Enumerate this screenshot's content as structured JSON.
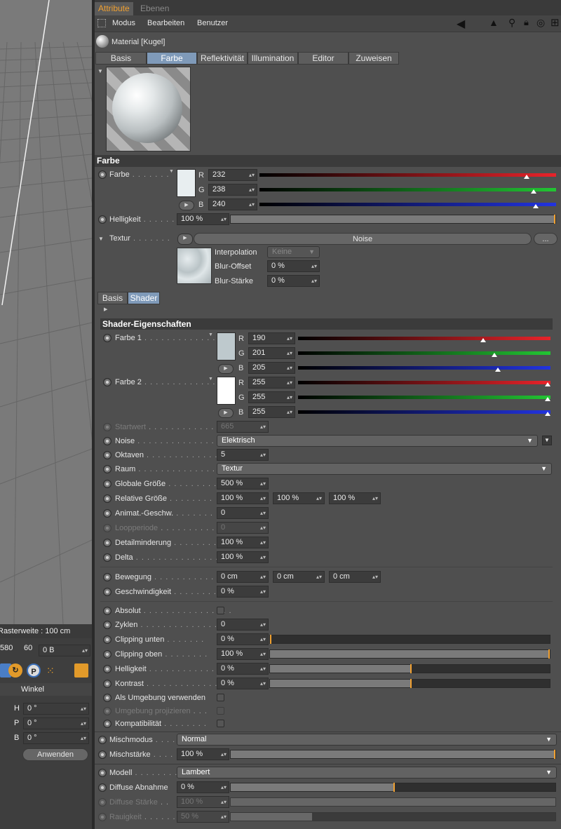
{
  "window_tabs": {
    "attribute": "Attribute",
    "ebenen": "Ebenen"
  },
  "menu": {
    "modus": "Modus",
    "bearbeiten": "Bearbeiten",
    "benutzer": "Benutzer"
  },
  "header": {
    "title": "Material [Kugel]"
  },
  "tabs": [
    "Basis",
    "Farbe",
    "Reflektivität",
    "Illumination",
    "Editor",
    "Zuweisen"
  ],
  "farbe_section": {
    "title": "Farbe",
    "farbe_label": "Farbe",
    "r": "232",
    "g": "238",
    "b": "240",
    "r_frac": 0.91,
    "g_frac": 0.933,
    "b_frac": 0.941,
    "swatch_color": "#e8eef0",
    "helligkeit_label": "Helligkeit",
    "helligkeit": "100 %",
    "textur_label": "Textur",
    "textur_button": "Noise",
    "more_button": "...",
    "interpolation_label": "Interpolation",
    "interpolation": "Keine",
    "blur_offset_label": "Blur-Offset",
    "blur_offset": "0 %",
    "blur_staerke_label": "Blur-Stärke",
    "blur_staerke": "0 %"
  },
  "shader_tabs": [
    "Basis",
    "Shader"
  ],
  "shader": {
    "title": "Shader-Eigenschaften",
    "farbe1_label": "Farbe 1",
    "farbe1": {
      "r": "190",
      "g": "201",
      "b": "205",
      "r_frac": 0.745,
      "g_frac": 0.788,
      "b_frac": 0.804,
      "color": "#bec9cd"
    },
    "farbe2_label": "Farbe 2",
    "farbe2": {
      "r": "255",
      "g": "255",
      "b": "255",
      "r_frac": 1.0,
      "g_frac": 1.0,
      "b_frac": 1.0,
      "color": "#ffffff"
    },
    "startwert_label": "Startwert",
    "startwert": "665",
    "noise_label": "Noise",
    "noise": "Elektrisch",
    "oktaven_label": "Oktaven",
    "oktaven": "5",
    "raum_label": "Raum",
    "raum": "Textur",
    "globale_groesse_label": "Globale Größe",
    "globale_groesse": "500 %",
    "relative_groesse_label": "Relative Größe",
    "relative_groesse": [
      "100 %",
      "100 %",
      "100 %"
    ],
    "animat_label": "Animat.-Geschw.",
    "animat": "0",
    "loopperiode_label": "Loopperiode",
    "loopperiode": "0",
    "detailminderung_label": "Detailminderung",
    "detailminderung": "100 %",
    "delta_label": "Delta",
    "delta": "100 %",
    "bewegung_label": "Bewegung",
    "bewegung": [
      "0 cm",
      "0 cm",
      "0 cm"
    ],
    "geschwindigkeit_label": "Geschwindigkeit",
    "geschwindigkeit": "0 %",
    "absolut_label": "Absolut",
    "zyklen_label": "Zyklen",
    "zyklen": "0",
    "clipping_unten_label": "Clipping unten",
    "clipping_unten": "0 %",
    "clipping_unten_frac": 0.0,
    "clipping_oben_label": "Clipping oben",
    "clipping_oben": "100 %",
    "clipping_oben_frac": 1.0,
    "helligkeit_label": "Helligkeit",
    "helligkeit": "0 %",
    "helligkeit_frac": 0.5,
    "kontrast_label": "Kontrast",
    "kontrast": "0 %",
    "kontrast_frac": 0.5,
    "als_umgebung_label": "Als Umgebung verwenden",
    "umgebung_projizieren_label": "Umgebung projizieren",
    "kompatibilitaet_label": "Kompatibilität"
  },
  "mix": {
    "mischmodus_label": "Mischmodus",
    "mischmodus": "Normal",
    "mischstaerke_label": "Mischstärke",
    "mischstaerke": "100 %",
    "mischstaerke_frac": 1.0
  },
  "modell": {
    "modell_label": "Modell",
    "modell": "Lambert",
    "diffuse_abnahme_label": "Diffuse Abnahme",
    "diffuse_abnahme": "0 %",
    "diffuse_abnahme_frac": 0.5,
    "diffuse_staerke_label": "Diffuse Stärke",
    "diffuse_staerke": "100 %",
    "rauigkeit_label": "Rauigkeit",
    "rauigkeit": "50 %",
    "rauigkeit_frac": 0.25
  },
  "viewport": {
    "rasterweite": "Rasterweite : 100 cm",
    "timeline_a": "580",
    "timeline_b": "60",
    "frame": "0 B",
    "winkel": "Winkel",
    "h_label": "H",
    "h": "0 °",
    "p_label": "P",
    "p": "0 °",
    "b_label": "B",
    "b": "0 °",
    "anwenden": "Anwenden"
  }
}
